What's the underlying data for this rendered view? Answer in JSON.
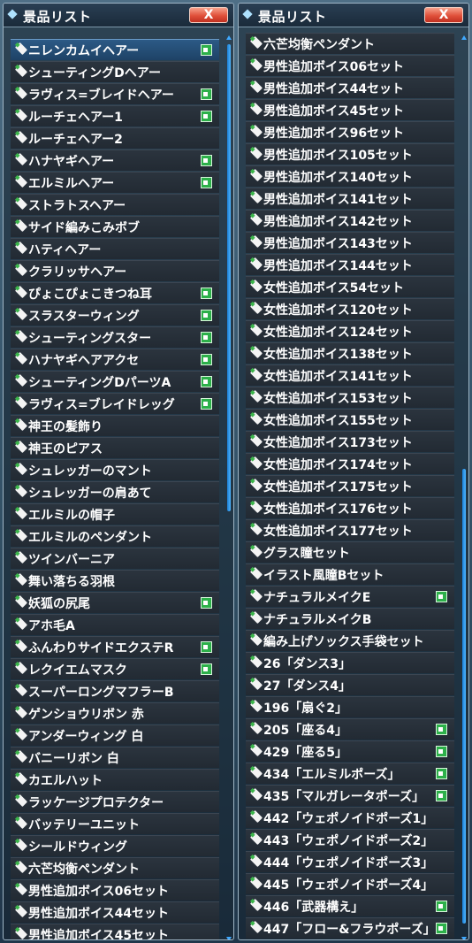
{
  "left_panel": {
    "title": "景品リスト",
    "close_label": "X",
    "items": [
      {
        "label": "ニレンカムイヘアー",
        "flag": true,
        "selected": true
      },
      {
        "label": "シューティングDヘアー",
        "flag": false
      },
      {
        "label": "ラヴィス=ブレイドヘアー",
        "flag": true
      },
      {
        "label": "ルーチェヘアー1",
        "flag": true
      },
      {
        "label": "ルーチェヘアー2",
        "flag": false
      },
      {
        "label": "ハナヤギヘアー",
        "flag": true
      },
      {
        "label": "エルミルヘアー",
        "flag": true
      },
      {
        "label": "ストラトスヘアー",
        "flag": false
      },
      {
        "label": "サイド編みこみボブ",
        "flag": false
      },
      {
        "label": "ハティヘアー",
        "flag": false
      },
      {
        "label": "クラリッサヘアー",
        "flag": false
      },
      {
        "label": "ぴょこぴょこきつね耳",
        "flag": true
      },
      {
        "label": "スラスターウィング",
        "flag": true
      },
      {
        "label": "シューティングスター",
        "flag": true
      },
      {
        "label": "ハナヤギヘアアクセ",
        "flag": true
      },
      {
        "label": "シューティングDパーツA",
        "flag": true
      },
      {
        "label": "ラヴィス=ブレイドレッグ",
        "flag": true
      },
      {
        "label": "神王の髪飾り",
        "flag": false
      },
      {
        "label": "神王のピアス",
        "flag": false
      },
      {
        "label": "シュレッガーのマント",
        "flag": false
      },
      {
        "label": "シュレッガーの肩あて",
        "flag": false
      },
      {
        "label": "エルミルの帽子",
        "flag": false
      },
      {
        "label": "エルミルのペンダント",
        "flag": false
      },
      {
        "label": "ツインバーニア",
        "flag": false
      },
      {
        "label": "舞い落ちる羽根",
        "flag": false
      },
      {
        "label": "妖狐の尻尾",
        "flag": true
      },
      {
        "label": "アホ毛A",
        "flag": false
      },
      {
        "label": "ふんわりサイドエクステR",
        "flag": true
      },
      {
        "label": "レクイエムマスク",
        "flag": true
      },
      {
        "label": "スーパーロングマフラーB",
        "flag": false
      },
      {
        "label": "ゲンショウリボン 赤",
        "flag": false
      },
      {
        "label": "アンダーウィング 白",
        "flag": false
      },
      {
        "label": "バニーリボン 白",
        "flag": false
      },
      {
        "label": "カエルハット",
        "flag": false
      },
      {
        "label": "ラッケージプロテクター",
        "flag": false
      },
      {
        "label": "バッテリーユニット",
        "flag": false
      },
      {
        "label": "シールドウィング",
        "flag": false
      },
      {
        "label": "六芒均衡ペンダント",
        "flag": false
      },
      {
        "label": "男性追加ボイス06セット",
        "flag": false
      },
      {
        "label": "男性追加ボイス44セット",
        "flag": false
      },
      {
        "label": "男性追加ボイス45セット",
        "flag": false
      }
    ]
  },
  "right_panel": {
    "title": "景品リスト",
    "close_label": "X",
    "items": [
      {
        "label": "六芒均衡ペンダント",
        "flag": false
      },
      {
        "label": "男性追加ボイス06セット",
        "flag": false
      },
      {
        "label": "男性追加ボイス44セット",
        "flag": false
      },
      {
        "label": "男性追加ボイス45セット",
        "flag": false
      },
      {
        "label": "男性追加ボイス96セット",
        "flag": false
      },
      {
        "label": "男性追加ボイス105セット",
        "flag": false
      },
      {
        "label": "男性追加ボイス140セット",
        "flag": false
      },
      {
        "label": "男性追加ボイス141セット",
        "flag": false
      },
      {
        "label": "男性追加ボイス142セット",
        "flag": false
      },
      {
        "label": "男性追加ボイス143セット",
        "flag": false
      },
      {
        "label": "男性追加ボイス144セット",
        "flag": false
      },
      {
        "label": "女性追加ボイス54セット",
        "flag": false
      },
      {
        "label": "女性追加ボイス120セット",
        "flag": false
      },
      {
        "label": "女性追加ボイス124セット",
        "flag": false
      },
      {
        "label": "女性追加ボイス138セット",
        "flag": false
      },
      {
        "label": "女性追加ボイス141セット",
        "flag": false
      },
      {
        "label": "女性追加ボイス153セット",
        "flag": false
      },
      {
        "label": "女性追加ボイス155セット",
        "flag": false
      },
      {
        "label": "女性追加ボイス173セット",
        "flag": false
      },
      {
        "label": "女性追加ボイス174セット",
        "flag": false
      },
      {
        "label": "女性追加ボイス175セット",
        "flag": false
      },
      {
        "label": "女性追加ボイス176セット",
        "flag": false
      },
      {
        "label": "女性追加ボイス177セット",
        "flag": false
      },
      {
        "label": "グラス瞳セット",
        "flag": false
      },
      {
        "label": "イラスト風瞳Bセット",
        "flag": false
      },
      {
        "label": "ナチュラルメイクE",
        "flag": true
      },
      {
        "label": "ナチュラルメイクB",
        "flag": false
      },
      {
        "label": "編み上げソックス手袋セット",
        "flag": false
      },
      {
        "label": "26「ダンス3」",
        "flag": false
      },
      {
        "label": "27「ダンス4」",
        "flag": false
      },
      {
        "label": "196「扇ぐ2」",
        "flag": false
      },
      {
        "label": "205「座る4」",
        "flag": true
      },
      {
        "label": "429「座る5」",
        "flag": true
      },
      {
        "label": "434「エルミルポーズ」",
        "flag": true
      },
      {
        "label": "435「マルガレータポーズ」",
        "flag": true
      },
      {
        "label": "442「ウェポノイドポーズ1」",
        "flag": false
      },
      {
        "label": "443「ウェポノイドポーズ2」",
        "flag": false
      },
      {
        "label": "444「ウェポノイドポーズ3」",
        "flag": false
      },
      {
        "label": "445「ウェポノイドポーズ4」",
        "flag": false
      },
      {
        "label": "446「武器構え」",
        "flag": true
      },
      {
        "label": "447「フロー&フラウポーズ」",
        "flag": true
      }
    ]
  }
}
